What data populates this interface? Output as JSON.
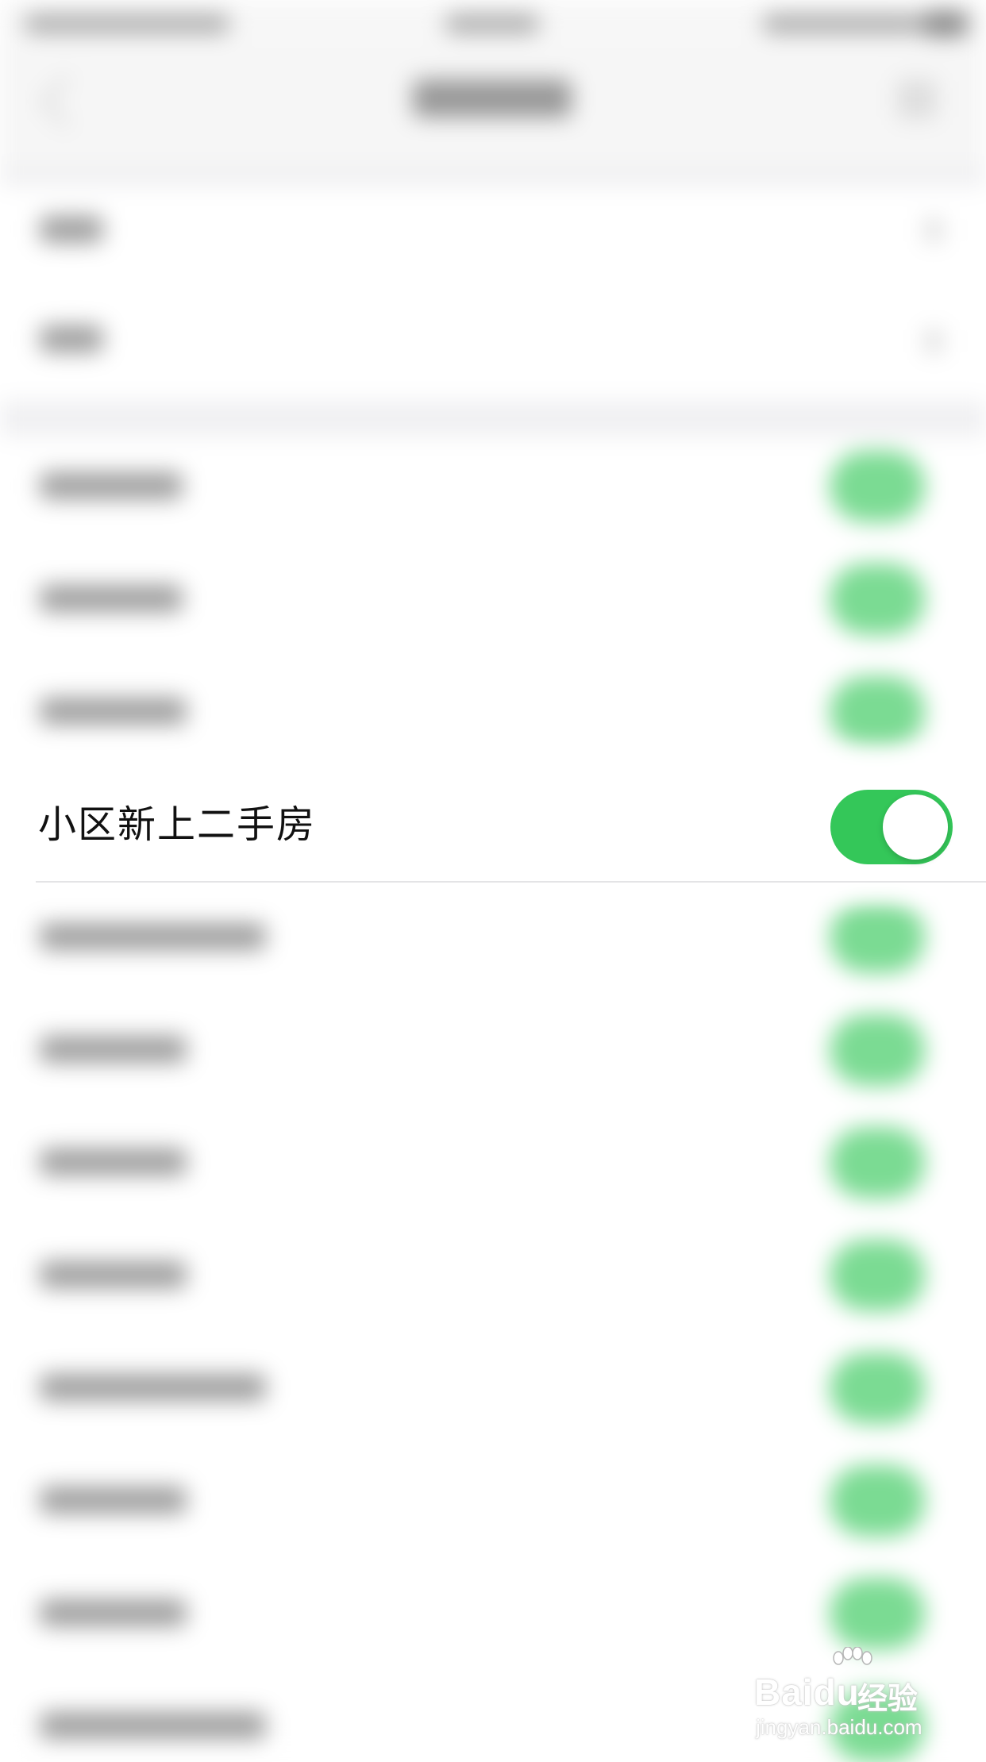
{
  "settings": {
    "highlighted_row": {
      "label": "小区新上二手房",
      "toggle_on": true
    }
  },
  "colors": {
    "toggle_on": "#34c759",
    "divider": "#e4e4e6",
    "label_text": "#111111"
  },
  "watermark": {
    "brand": "Baidu",
    "sub": "经验",
    "url": "jingyan.baidu.com"
  }
}
